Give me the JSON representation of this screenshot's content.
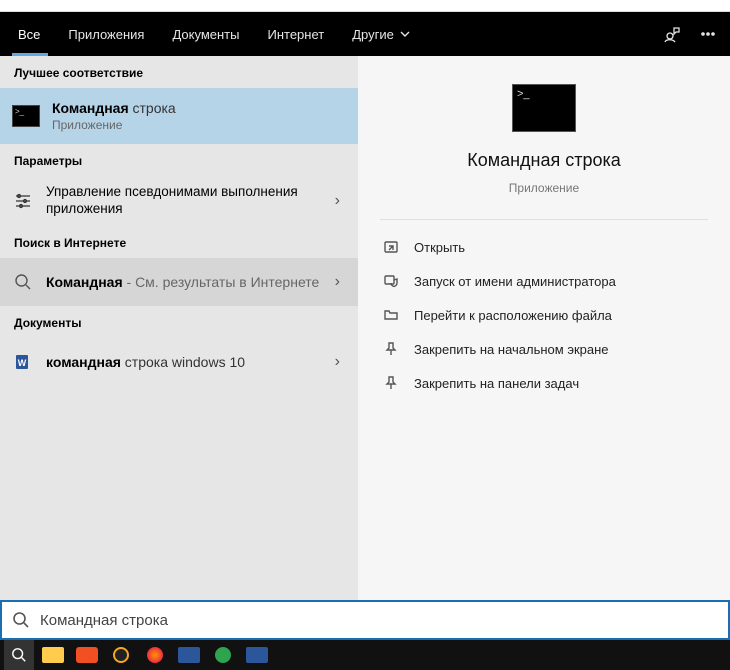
{
  "topbar": {
    "tabs": [
      {
        "label": "Все",
        "active": true
      },
      {
        "label": "Приложения",
        "active": false
      },
      {
        "label": "Документы",
        "active": false
      },
      {
        "label": "Интернет",
        "active": false
      },
      {
        "label": "Другие",
        "active": false,
        "dropdown": true
      }
    ]
  },
  "left": {
    "best_match_header": "Лучшее соответствие",
    "best_match": {
      "title_bold": "Командная",
      "title_light": "строка",
      "subtitle": "Приложение"
    },
    "settings_header": "Параметры",
    "settings_item": {
      "title": "Управление псевдонимами выполнения приложения"
    },
    "web_header": "Поиск в Интернете",
    "web_item": {
      "title_bold": "Командная",
      "title_rest": " - См. результаты в Интернете"
    },
    "docs_header": "Документы",
    "docs_item": {
      "title_bold": "командная",
      "title_light": "строка windows 10"
    }
  },
  "detail": {
    "title": "Командная строка",
    "subtitle": "Приложение",
    "actions": [
      {
        "icon": "open",
        "label": "Открыть"
      },
      {
        "icon": "admin",
        "label": "Запуск от имени администратора"
      },
      {
        "icon": "folder",
        "label": "Перейти к расположению файла"
      },
      {
        "icon": "pin-start",
        "label": "Закрепить на начальном экране"
      },
      {
        "icon": "pin-task",
        "label": "Закрепить на панели задач"
      }
    ]
  },
  "search": {
    "value": "Командная строка"
  }
}
